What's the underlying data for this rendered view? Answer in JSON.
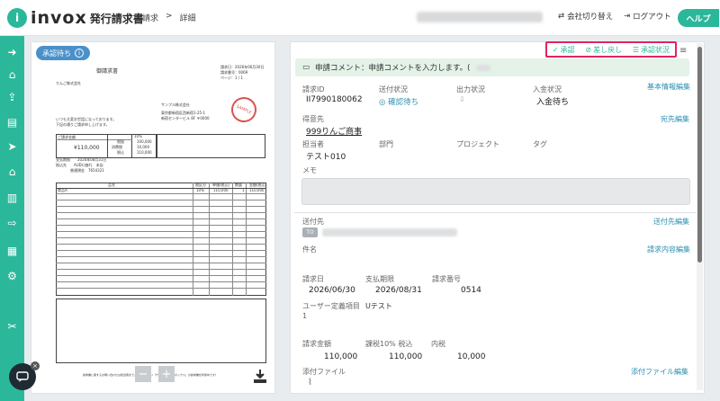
{
  "header": {
    "logo_text": "invox",
    "logo_sub": "発行請求書",
    "breadcrumb": [
      "請求",
      "詳細"
    ],
    "switch_company": "会社切り替え",
    "logout": "ログアウト",
    "help": "ヘルプ"
  },
  "sidebar": {
    "icons": [
      "arrow-right-icon",
      "home-icon",
      "upload-icon",
      "document-icon",
      "send-icon",
      "bank-icon",
      "building-icon",
      "export-icon",
      "chart-icon",
      "gear-icon",
      "tools-icon"
    ]
  },
  "doc": {
    "status_pill": "承認待ち",
    "title": "御請求書",
    "to": "りんご株式会社",
    "issue_info": [
      "請求日：2026年06月30日",
      "請求番号：0069",
      "ページ：1 / 1"
    ],
    "from_company": "サンプル株式会社",
    "from_address": [
      "東京都新宿区西新宿1-25-1",
      "新宿センタービル 8F 〒0000"
    ],
    "greeting": [
      "いつも大変お世話になっております。",
      "下記の通りご請求申し上げます。"
    ],
    "billing_label": "ご請求金額",
    "billing_amount": "¥110,000",
    "tax_rows": [
      [
        "10%",
        ""
      ],
      [
        "税抜",
        "100,000"
      ],
      [
        "消費税",
        "10,000"
      ],
      [
        "税込",
        "110,000"
      ]
    ],
    "payment_info": [
      "支払期限　　2026年08月31日",
      "振込先　　AUD口座行　本店",
      "　　　　普通預金　7654321"
    ],
    "table_headers": [
      "品名",
      "税区分",
      "単価(税込)",
      "数量",
      "金額(税込)"
    ],
    "table_first_row": [
      "商品A",
      "10%",
      "110,000",
      "1",
      "110,000"
    ],
    "stamp_text": "SAMPLE",
    "footer_note": "請求書に関するお問い合わせは担当者までご連絡ください（サービス「インボックス」の請求書を利用中です）"
  },
  "actions": {
    "approve": "承認",
    "reject": "差し戻し",
    "status": "承認状況"
  },
  "comment": {
    "text": "申請コメント：申請コメントを入力します。("
  },
  "fields": {
    "invoice_id_label": "請求ID",
    "invoice_id": "II7990180062",
    "send_status_label": "送付状況",
    "send_status": "確認待ち",
    "output_status_label": "出力状況",
    "payment_status_label": "入金状況",
    "payment_status": "入金待ち",
    "basic_edit": "基本情報編集",
    "customer_label": "得意先",
    "customer": "999りんご商事",
    "customer_edit": "宛先編集",
    "person_label": "担当者",
    "person": "テスト010",
    "dept_label": "部門",
    "project_label": "プロジェクト",
    "tag_label": "タグ",
    "memo_label": "メモ",
    "send_to_label": "送付先",
    "send_to_tag": "TO",
    "send_to_edit": "送付先編集",
    "subject_label": "件名",
    "content_edit": "請求内容編集",
    "invoice_date_label": "請求日",
    "invoice_date": "2026/06/30",
    "due_label": "支払期限",
    "due": "2026/08/31",
    "number_label": "請求番号",
    "number": "0514",
    "custom_label": "ユーザー定義項目",
    "custom_value": "Uテスト",
    "custom_index": "1",
    "amount_label": "請求金額",
    "amount": "110,000",
    "tax_label": "課税10% 税込",
    "tax": "110,000",
    "inner_tax_label": "内税",
    "inner_tax": "10,000",
    "attach_label": "添付ファイル",
    "attach_edit": "添付ファイル編集"
  },
  "colors": {
    "brand": "#2bb89a",
    "link": "#2b8fb0",
    "highlight": "#e0245e",
    "pill": "#4a90c9"
  }
}
